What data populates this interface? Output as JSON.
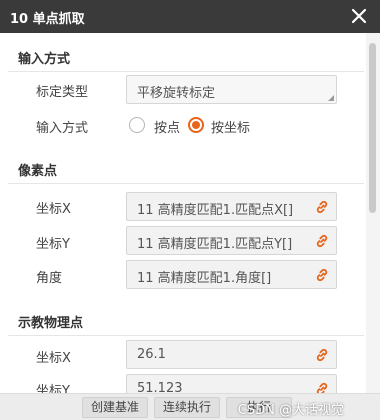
{
  "window": {
    "title": "10 单点抓取"
  },
  "sections": {
    "input_mode": {
      "title": "输入方式",
      "calib_type_label": "标定类型",
      "calib_type_value": "平移旋转标定",
      "input_mode_label": "输入方式",
      "options": [
        {
          "label": "按点",
          "selected": false
        },
        {
          "label": "按坐标",
          "selected": true
        }
      ]
    },
    "pixel_point": {
      "title": "像素点",
      "x_label": "坐标X",
      "x_value": "11 高精度匹配1.匹配点X[]",
      "y_label": "坐标Y",
      "y_value": "11 高精度匹配1.匹配点Y[]",
      "angle_label": "角度",
      "angle_value": "11 高精度匹配1.角度[]"
    },
    "teach_point": {
      "title": "示教物理点",
      "x_label": "坐标X",
      "x_value": "26.1",
      "y_label": "坐标Y",
      "y_value": "51.123"
    }
  },
  "footer": {
    "create_base_label": "创建基准",
    "continuous_run_label": "连续执行",
    "extra_label": "执行"
  },
  "watermark": "CSDN @大话视觉",
  "colors": {
    "titlebar": "#3a3a3a",
    "accent": "#e8641b",
    "field_bg": "#f2f2f2"
  },
  "icons": [
    "close-icon",
    "link-icon",
    "dropdown-corner-icon"
  ]
}
